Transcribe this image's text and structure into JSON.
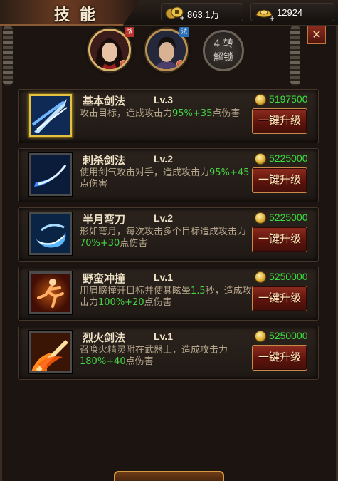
{
  "header": {
    "title": "技能",
    "gold_value": "863.1万",
    "ingot_value": "12924"
  },
  "heroes": [
    {
      "badge": "战",
      "badge_color": "#b8322a"
    },
    {
      "badge": "法",
      "badge_color": "#2a6fb8"
    }
  ],
  "locked_hero": {
    "line1": "4 转",
    "line2": "解锁"
  },
  "skills": [
    {
      "name": "基本剑法",
      "level": "Lv.3",
      "desc_a": "攻击目标，造成攻击力",
      "hl_1": "95%+35",
      "desc_b": "点伤害",
      "desc_c": "",
      "cost": "5197500",
      "button": "一键升级",
      "icon": "sword-slash-icon"
    },
    {
      "name": "刺杀剑法",
      "level": "Lv.2",
      "desc_a": "使用剑气攻击对手，造成攻击力",
      "hl_1": "95%",
      "desc_b": "",
      "hl_2": "+45",
      "desc_c": "点伤害",
      "cost": "5225000",
      "button": "一键升级",
      "icon": "thrust-wave-icon"
    },
    {
      "name": "半月弯刀",
      "level": "Lv.2",
      "desc_a": "形如弯月，每次攻击多个目标造成攻击力",
      "hl_1": "70%+30",
      "desc_b": "点伤害",
      "cost": "5225000",
      "button": "一键升级",
      "icon": "crescent-blade-icon"
    },
    {
      "name": "野蛮冲撞",
      "level": "Lv.1",
      "desc_a": "用肩膀撞开目标并使其眩晕",
      "hl_1": "1.5",
      "desc_b": "秒，造成攻击力",
      "hl_2": "100%+20",
      "desc_c": "点伤害",
      "cost": "5250000",
      "button": "一键升级",
      "icon": "charging-runner-icon"
    },
    {
      "name": "烈火剑法",
      "level": "Lv.1",
      "desc_a": "召唤火精灵附在武器上，造成攻击力",
      "hl_1": "180%+40",
      "desc_b": "点伤害",
      "cost": "5250000",
      "button": "一键升级",
      "icon": "flame-sword-icon"
    }
  ]
}
